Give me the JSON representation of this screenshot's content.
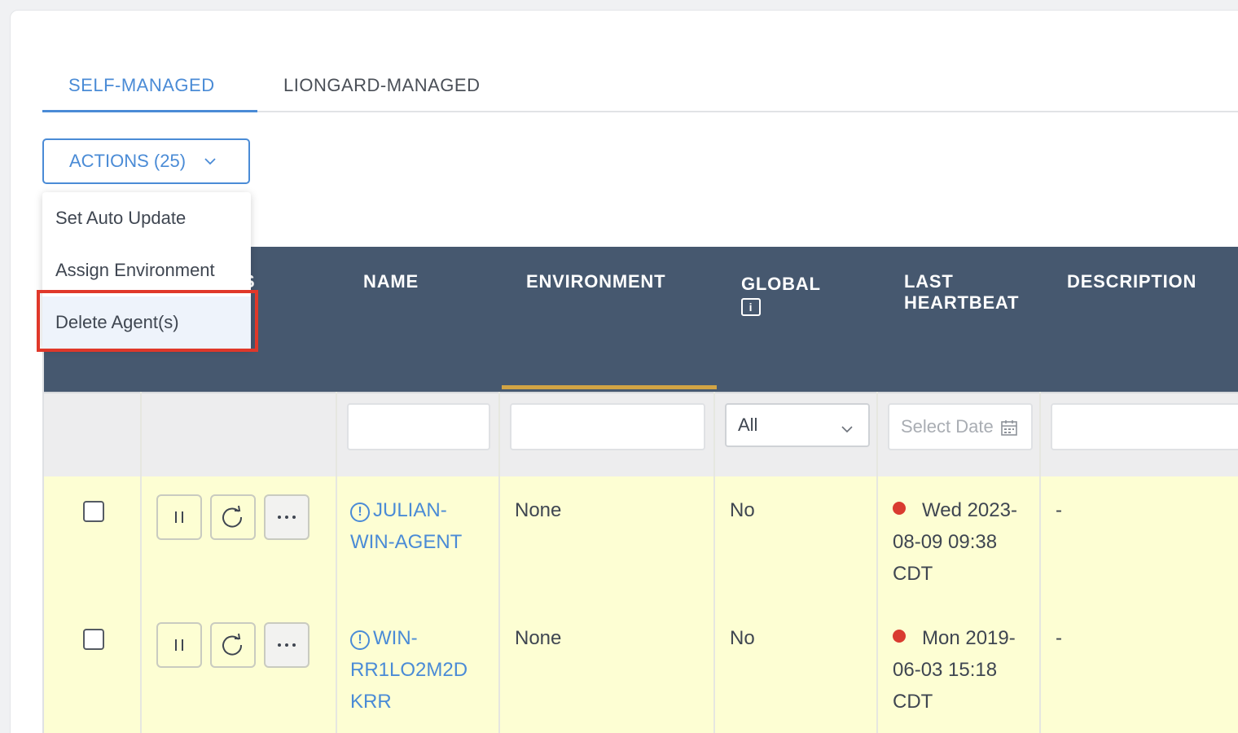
{
  "tabs": [
    {
      "label": "SELF-MANAGED",
      "active": true
    },
    {
      "label": "LIONGARD-MANAGED",
      "active": false
    }
  ],
  "actions": {
    "label": "ACTIONS (25)",
    "icon": "chevron-down-icon"
  },
  "menu": {
    "items": [
      {
        "label": "Set Auto Update"
      },
      {
        "label": "Assign Environment"
      },
      {
        "label": "Delete Agent(s)",
        "highlighted": true
      }
    ]
  },
  "table": {
    "columns": {
      "status_partial": "S",
      "name": "NAME",
      "environment": "ENVIRONMENT",
      "global": "GLOBAL",
      "global_info": "i",
      "last_heartbeat_1": "LAST",
      "last_heartbeat_2": "HEARTBEAT",
      "description": "DESCRIPTION"
    },
    "filters": {
      "global_value": "All",
      "date_placeholder": "Select Date"
    },
    "rows": [
      {
        "name_1": "JULIAN-",
        "name_2": "WIN-AGENT",
        "environment": "None",
        "global": "No",
        "heartbeat_1": "Wed 2023-",
        "heartbeat_2": "08-09 09:38",
        "heartbeat_3": "CDT",
        "description": "-"
      },
      {
        "name_1": "WIN-",
        "name_2": "RR1LO2M2D",
        "name_3": "KRR",
        "environment": "None",
        "global": "No",
        "heartbeat_1": "Mon 2019-",
        "heartbeat_2": "06-03 15:18",
        "heartbeat_3": "CDT",
        "description": "-"
      }
    ]
  },
  "colors": {
    "accent": "#4a8bd6",
    "header_bg": "#46586f",
    "row_bg": "#fdfed3",
    "status_offline": "#d93b30",
    "highlight_border": "#e0382a",
    "sort_indicator": "#d2a444"
  }
}
